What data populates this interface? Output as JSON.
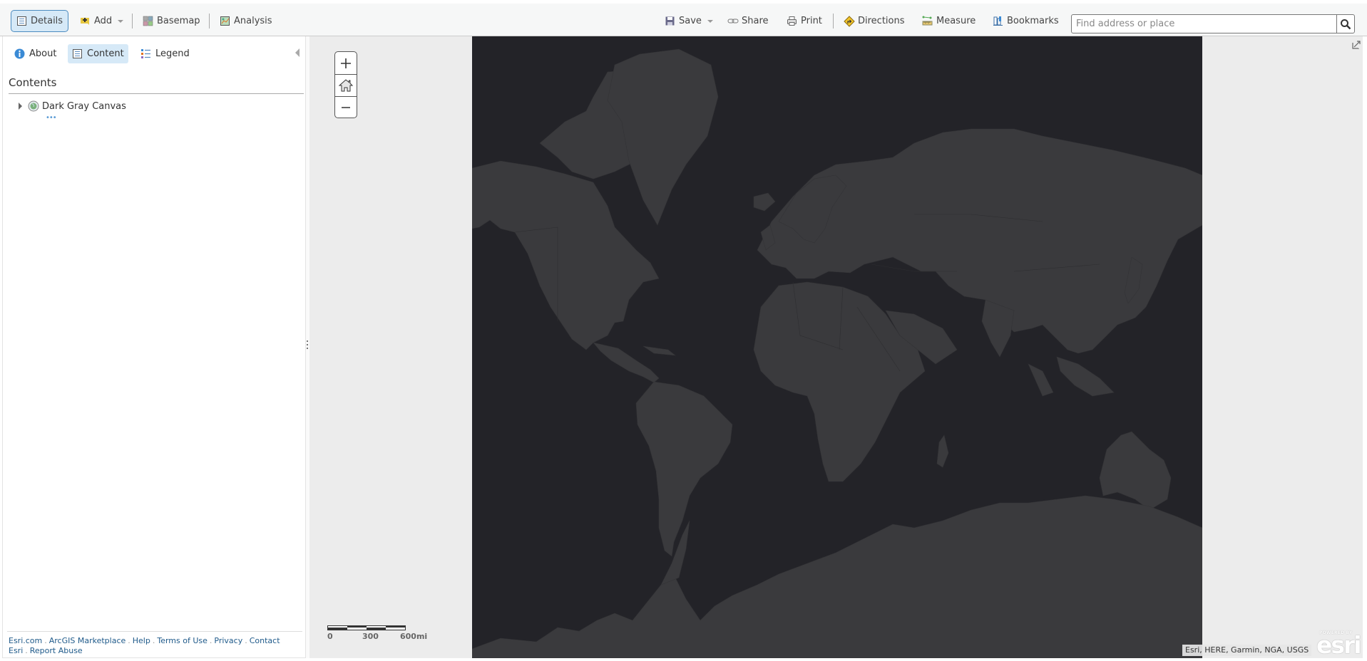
{
  "toolbar": {
    "left": [
      {
        "label": "Details",
        "icon": "details-icon",
        "active": true
      },
      {
        "label": "Add",
        "icon": "add-icon",
        "dropdown": true
      },
      {
        "label": "Basemap",
        "icon": "basemap-icon"
      },
      {
        "label": "Analysis",
        "icon": "analysis-icon"
      }
    ],
    "right": [
      {
        "label": "Save",
        "icon": "save-icon",
        "dropdown": true
      },
      {
        "label": "Share",
        "icon": "share-icon"
      },
      {
        "label": "Print",
        "icon": "print-icon"
      },
      {
        "label": "Directions",
        "icon": "directions-icon"
      },
      {
        "label": "Measure",
        "icon": "measure-icon"
      },
      {
        "label": "Bookmarks",
        "icon": "bookmarks-icon"
      }
    ],
    "search": {
      "value": "",
      "placeholder": "Find address or place",
      "icon": "search-icon"
    }
  },
  "panel": {
    "tabs": [
      {
        "label": "About",
        "icon": "info-icon"
      },
      {
        "label": "Content",
        "icon": "content-icon",
        "active": true
      },
      {
        "label": "Legend",
        "icon": "legend-icon"
      }
    ],
    "contents_title": "Contents",
    "layers": [
      {
        "name": "Dark Gray Canvas",
        "more": "•••"
      }
    ],
    "footer_links": [
      "Esri.com",
      "ArcGIS Marketplace",
      "Help",
      "Terms of Use",
      "Privacy",
      "Contact Esri",
      "Report Abuse"
    ]
  },
  "map": {
    "basemap": "Dark Gray Canvas",
    "colors": {
      "ocean": "#232328",
      "land": "#3a3a3d",
      "border": "#4a4a4e",
      "panel_bg": "#ececec",
      "accent": "#d6e9f7"
    },
    "zoom_controls": {
      "zoom_in": "+",
      "home": "home-icon",
      "zoom_out": "−"
    },
    "scalebar": {
      "labels": [
        "0",
        "300",
        "600mi"
      ]
    },
    "attribution": "Esri, HERE, Garmin, NGA, USGS",
    "logo": {
      "top": "POWERED BY",
      "word": "esri"
    }
  }
}
